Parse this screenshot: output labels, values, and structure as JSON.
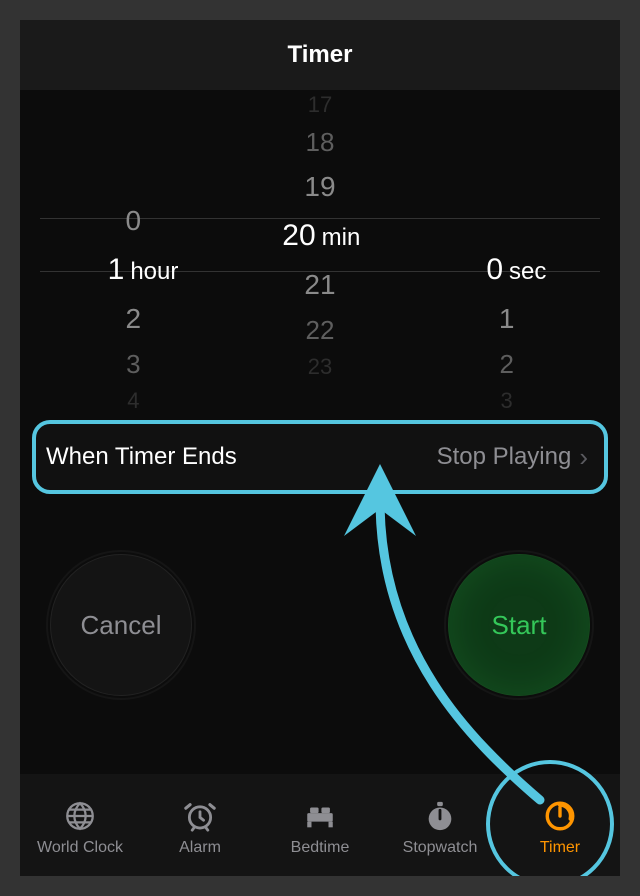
{
  "header": {
    "title": "Timer"
  },
  "picker": {
    "hours": {
      "above": [
        "0"
      ],
      "selected": "1",
      "unit": "hour",
      "below": [
        "2",
        "3",
        "4"
      ]
    },
    "minutes": {
      "above": [
        "17",
        "18",
        "19"
      ],
      "selected": "20",
      "unit": "min",
      "below": [
        "21",
        "22",
        "23"
      ]
    },
    "seconds": {
      "above": [],
      "selected": "0",
      "unit": "sec",
      "below": [
        "1",
        "2",
        "3"
      ]
    }
  },
  "when_ends": {
    "label": "When Timer Ends",
    "value": "Stop Playing"
  },
  "buttons": {
    "cancel": "Cancel",
    "start": "Start"
  },
  "tabs": [
    {
      "label": "World Clock",
      "icon": "globe-icon",
      "active": false
    },
    {
      "label": "Alarm",
      "icon": "alarm-icon",
      "active": false
    },
    {
      "label": "Bedtime",
      "icon": "bed-icon",
      "active": false
    },
    {
      "label": "Stopwatch",
      "icon": "stopwatch-icon",
      "active": false
    },
    {
      "label": "Timer",
      "icon": "timer-icon",
      "active": true
    }
  ],
  "colors": {
    "accent_orange": "#ff9500",
    "accent_green": "#34c759",
    "annotation": "#55c6e0"
  }
}
